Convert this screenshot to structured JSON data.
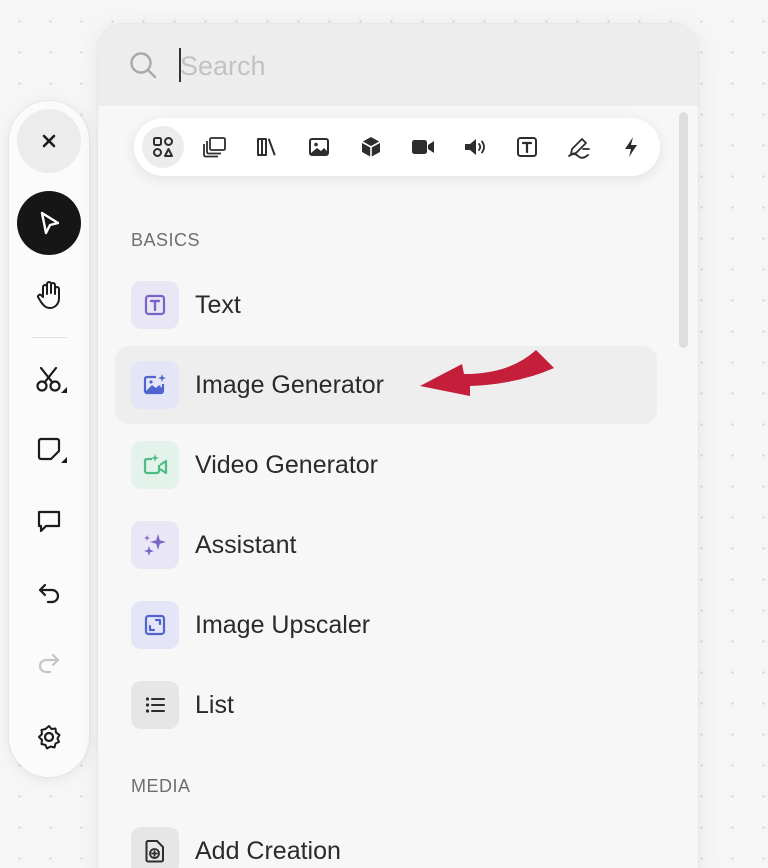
{
  "search": {
    "placeholder": "Search"
  },
  "categories": [
    {
      "icon": "all-grid-icon",
      "selected": true
    },
    {
      "icon": "layers-icon"
    },
    {
      "icon": "library-icon"
    },
    {
      "icon": "image-icon"
    },
    {
      "icon": "cube-3d-icon"
    },
    {
      "icon": "video-icon"
    },
    {
      "icon": "audio-icon"
    },
    {
      "icon": "text-box-icon"
    },
    {
      "icon": "sign-pen-icon"
    },
    {
      "icon": "lightning-icon"
    }
  ],
  "sections": {
    "basics": "BASICS",
    "media": "MEDIA"
  },
  "items": [
    {
      "label": "Text",
      "icon": "text-box-icon",
      "icon_bg": "#e9e6f6",
      "icon_color": "#7a64c8"
    },
    {
      "label": "Image Generator",
      "icon": "image-sparkle-icon",
      "icon_bg": "#e4e6f7",
      "icon_color": "#4f64cf"
    },
    {
      "label": "Video Generator",
      "icon": "video-sparkle-icon",
      "icon_bg": "#e3f2ea",
      "icon_color": "#4cbc84"
    },
    {
      "label": "Assistant",
      "icon": "sparkles-icon",
      "icon_bg": "#e9e6f6",
      "icon_color": "#7a64c8"
    },
    {
      "label": "Image Upscaler",
      "icon": "upscale-icon",
      "icon_bg": "#e4e6f7",
      "icon_color": "#4f64cf"
    },
    {
      "label": "List",
      "icon": "list-icon",
      "icon_bg": "#e6e6e6",
      "icon_color": "#2d2d2d"
    },
    {
      "label": "Add Creation",
      "icon": "add-file-icon",
      "icon_bg": "#e6e6e6",
      "icon_color": "#2d2d2d"
    }
  ],
  "toolbar": [
    {
      "icon": "close-icon"
    },
    {
      "icon": "pointer-icon",
      "active": true
    },
    {
      "icon": "hand-icon"
    },
    {
      "icon": "scissors-icon"
    },
    {
      "icon": "sticky-note-icon"
    },
    {
      "icon": "comment-icon"
    },
    {
      "icon": "undo-icon"
    },
    {
      "icon": "redo-icon",
      "disabled": true
    },
    {
      "icon": "settings-gear-icon"
    }
  ],
  "colors": {
    "annotation_arrow": "#c41e3a",
    "active_tool": "#161616"
  }
}
